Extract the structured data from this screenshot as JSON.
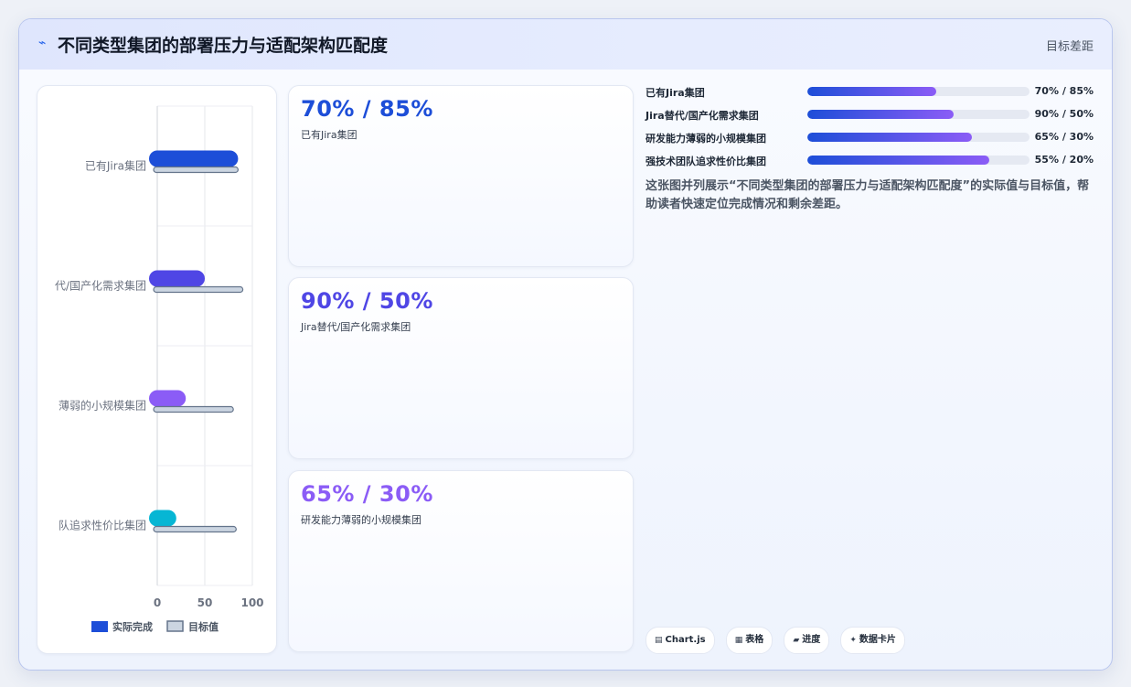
{
  "header": {
    "icon": "trend-line-icon",
    "title": "不同类型集团的部署压力与适配架构匹配度",
    "badge": "目标差距"
  },
  "colors": {
    "actual": [
      "#1d4ed8",
      "#4f46e5",
      "#8b5cf6",
      "#06b6d4"
    ],
    "target_fill": "#cbd5e1",
    "target_stroke": "#64748b",
    "kpi": [
      "#1d4ed8",
      "#4f46e5",
      "#8b5cf6"
    ]
  },
  "chart_data": {
    "type": "bar",
    "orientation": "horizontal",
    "categories": [
      "已有Jira集团",
      "Jira替代/国产化需求集团",
      "研发能力薄弱的小规模集团",
      "强技术团队追求性价比集团"
    ],
    "category_labels_visible": [
      "已有Jira集团",
      "代/国产化需求集团",
      "薄弱的小规模集团",
      "队追求性价比集团"
    ],
    "series": [
      {
        "name": "实际完成",
        "values": [
          85,
          50,
          30,
          20
        ]
      },
      {
        "name": "目标值",
        "values": [
          85,
          90,
          80,
          83
        ]
      }
    ],
    "xlim": [
      0,
      100
    ],
    "xticks": [
      0,
      50,
      100
    ],
    "grid": true,
    "legend": "bottom"
  },
  "kpis": [
    {
      "value": "70% / 85%",
      "label": "已有Jira集团"
    },
    {
      "value": "90% / 50%",
      "label": "Jira替代/国产化需求集团"
    },
    {
      "value": "65% / 30%",
      "label": "研发能力薄弱的小规模集团"
    }
  ],
  "progress": [
    {
      "label": "已有Jira集团",
      "value": "70% / 85%",
      "level": 0.58
    },
    {
      "label": "Jira替代/国产化需求集团",
      "value": "90% / 50%",
      "level": 0.66
    },
    {
      "label": "研发能力薄弱的小规模集团",
      "value": "65% / 30%",
      "level": 0.74
    },
    {
      "label": "强技术团队追求性价比集团",
      "value": "55% / 20%",
      "level": 0.82
    }
  ],
  "description": "这张图并列展示“不同类型集团的部署压力与适配架构匹配度”的实际值与目标值，帮助读者快速定位完成情况和剩余差距。",
  "tags": [
    {
      "icon": "chart-icon",
      "glyph": "▤",
      "label": "Chart.js"
    },
    {
      "icon": "table-icon",
      "glyph": "▦",
      "label": "表格"
    },
    {
      "icon": "progress-icon",
      "glyph": "▰",
      "label": "进度"
    },
    {
      "icon": "sparkle-icon",
      "glyph": "✦",
      "label": "数据卡片"
    }
  ]
}
